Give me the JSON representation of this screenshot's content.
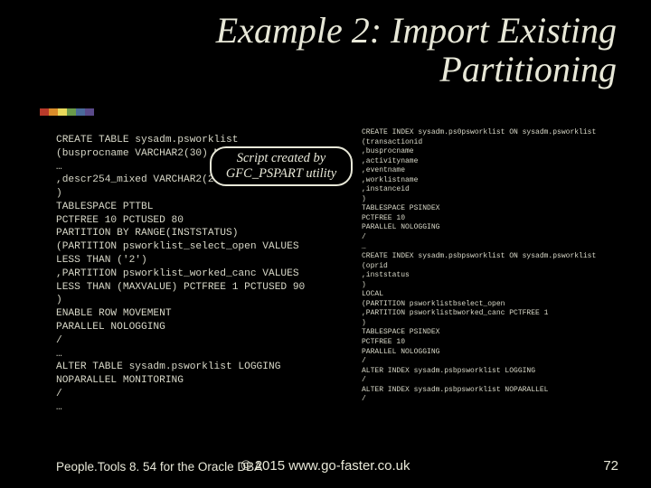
{
  "title": "Example 2: Import Existing Partitioning",
  "accent_colors": [
    "#b83a2a",
    "#d98c2a",
    "#e8d85a",
    "#6a9a4a",
    "#4a6a9a",
    "#5a4a8a"
  ],
  "callout": {
    "line1": "Script created by",
    "line2": "GFC_PSPART utility"
  },
  "code_left": "CREATE TABLE sysadm.psworklist\n(busprocname VARCHAR2(30) NOT NULL\n…\n,descr254_mixed VARCHAR2(254) NOT NULL\n)\nTABLESPACE PTTBL\nPCTFREE 10 PCTUSED 80\nPARTITION BY RANGE(INSTSTATUS)\n(PARTITION psworklist_select_open VALUES\nLESS THAN ('2')\n,PARTITION psworklist_worked_canc VALUES\nLESS THAN (MAXVALUE) PCTFREE 1 PCTUSED 90\n)\nENABLE ROW MOVEMENT\nPARALLEL NOLOGGING\n/\n…\nALTER TABLE sysadm.psworklist LOGGING\nNOPARALLEL MONITORING\n/\n…",
  "code_right": "CREATE INDEX sysadm.ps0psworklist ON sysadm.psworklist\n(transactionid\n,busprocname\n,activityname\n,eventname\n,worklistname\n,instanceid\n)\nTABLESPACE PSINDEX\nPCTFREE 10\nPARALLEL NOLOGGING\n/\n…\nCREATE INDEX sysadm.psbpsworklist ON sysadm.psworklist\n(oprid\n,inststatus\n)\nLOCAL\n(PARTITION psworklistbselect_open\n,PARTITION psworklistbworked_canc PCTFREE 1\n)\nTABLESPACE PSINDEX\nPCTFREE 10\nPARALLEL NOLOGGING\n/\nALTER INDEX sysadm.psbpsworklist LOGGING\n/\nALTER INDEX sysadm.psbpsworklist NOPARALLEL\n/",
  "footer": {
    "left": "People.Tools 8. 54 for the Oracle DBA",
    "center": "© 2015 www.go-faster.co.uk",
    "right": "72"
  }
}
